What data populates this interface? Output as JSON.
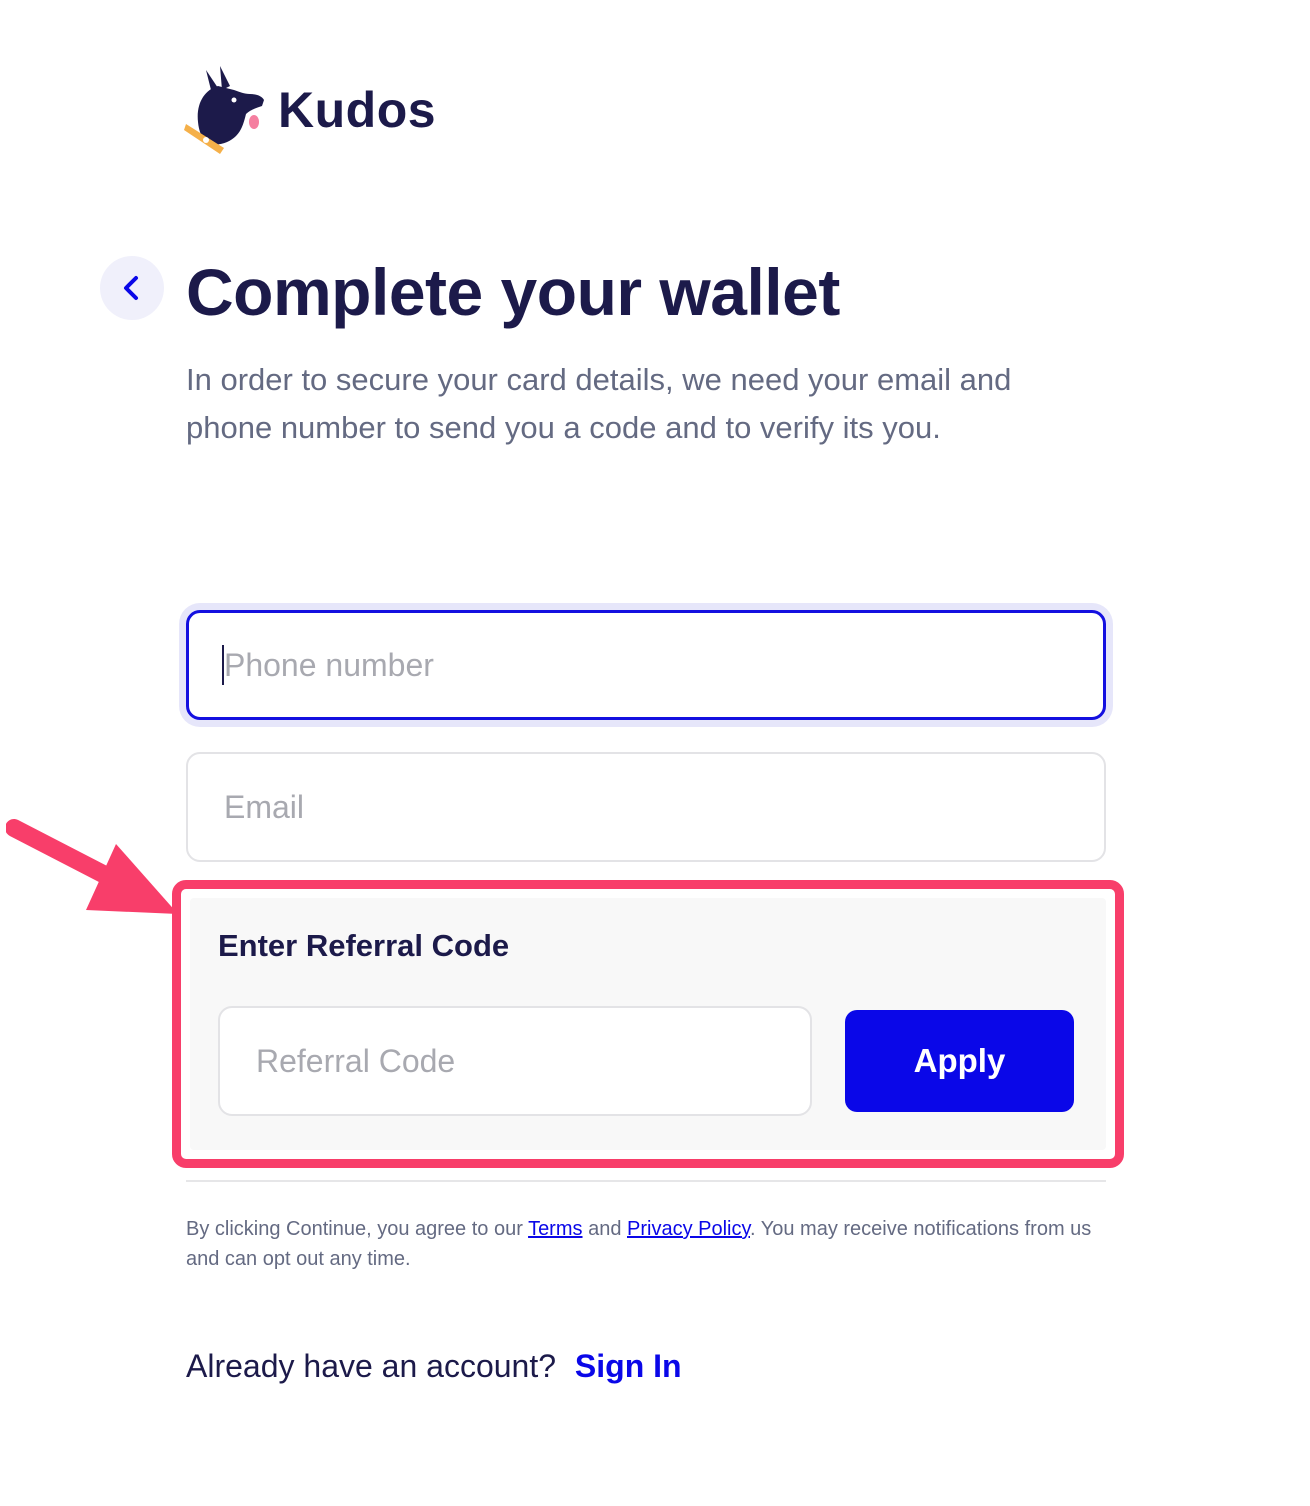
{
  "brand": {
    "name": "Kudos"
  },
  "header": {
    "title": "Complete your wallet",
    "subtitle": "In order to secure your card details, we need your email and phone number to send you a code and to verify its you."
  },
  "form": {
    "phone": {
      "placeholder": "Phone number",
      "value": ""
    },
    "email": {
      "placeholder": "Email",
      "value": ""
    }
  },
  "referral": {
    "title": "Enter Referral Code",
    "input_placeholder": "Referral Code",
    "apply_label": "Apply"
  },
  "legal": {
    "before_terms": "By clicking Continue, you agree to our ",
    "terms_link": "Terms",
    "and_text": " and ",
    "privacy_link": "Privacy Policy",
    "after_links": ". You may receive notifications from us and can opt out any time."
  },
  "footer": {
    "prompt": "Already have an account?",
    "signin_link": "Sign In"
  },
  "icons": {
    "back": "chevron-left-icon",
    "logo": "dog-head-logo",
    "annotation": "arrow-annotation"
  },
  "colors": {
    "primary": "#0a07e8",
    "text_dark": "#1c1a4a",
    "text_muted": "#646a82",
    "highlight": "#f83e6a"
  }
}
